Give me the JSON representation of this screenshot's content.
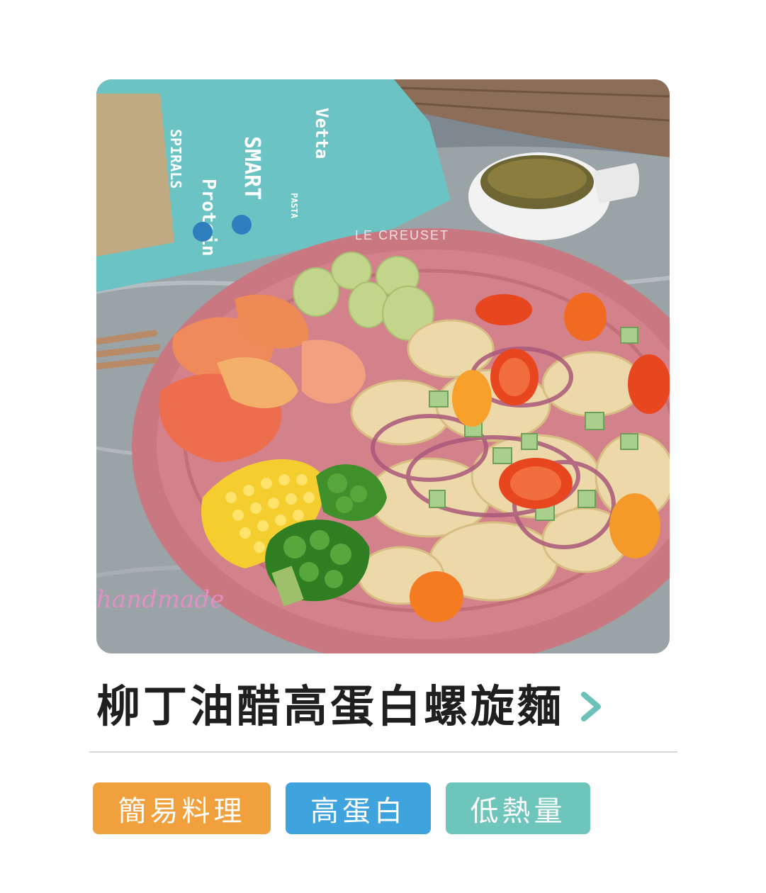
{
  "recipe": {
    "title": "柳丁油醋高蛋白螺旋麵",
    "photo": {
      "package_brand": "Vetta",
      "package_name": "SMART",
      "package_product": "Protein",
      "package_type": "SPIRALS",
      "package_sub": "PASTA",
      "plate_brand": "LE CREUSET",
      "watermark": "handmade"
    },
    "tags": [
      {
        "label": "簡易料理",
        "color": "#f0a03c"
      },
      {
        "label": "高蛋白",
        "color": "#3fa3de"
      },
      {
        "label": "低熱量",
        "color": "#6ec5bb"
      }
    ]
  },
  "colors": {
    "accent_chevron": "#6cc2b8",
    "title": "#1f1f1f",
    "divider": "#d5d5d5"
  },
  "icons": {
    "chevron": "chevron-right-icon"
  }
}
